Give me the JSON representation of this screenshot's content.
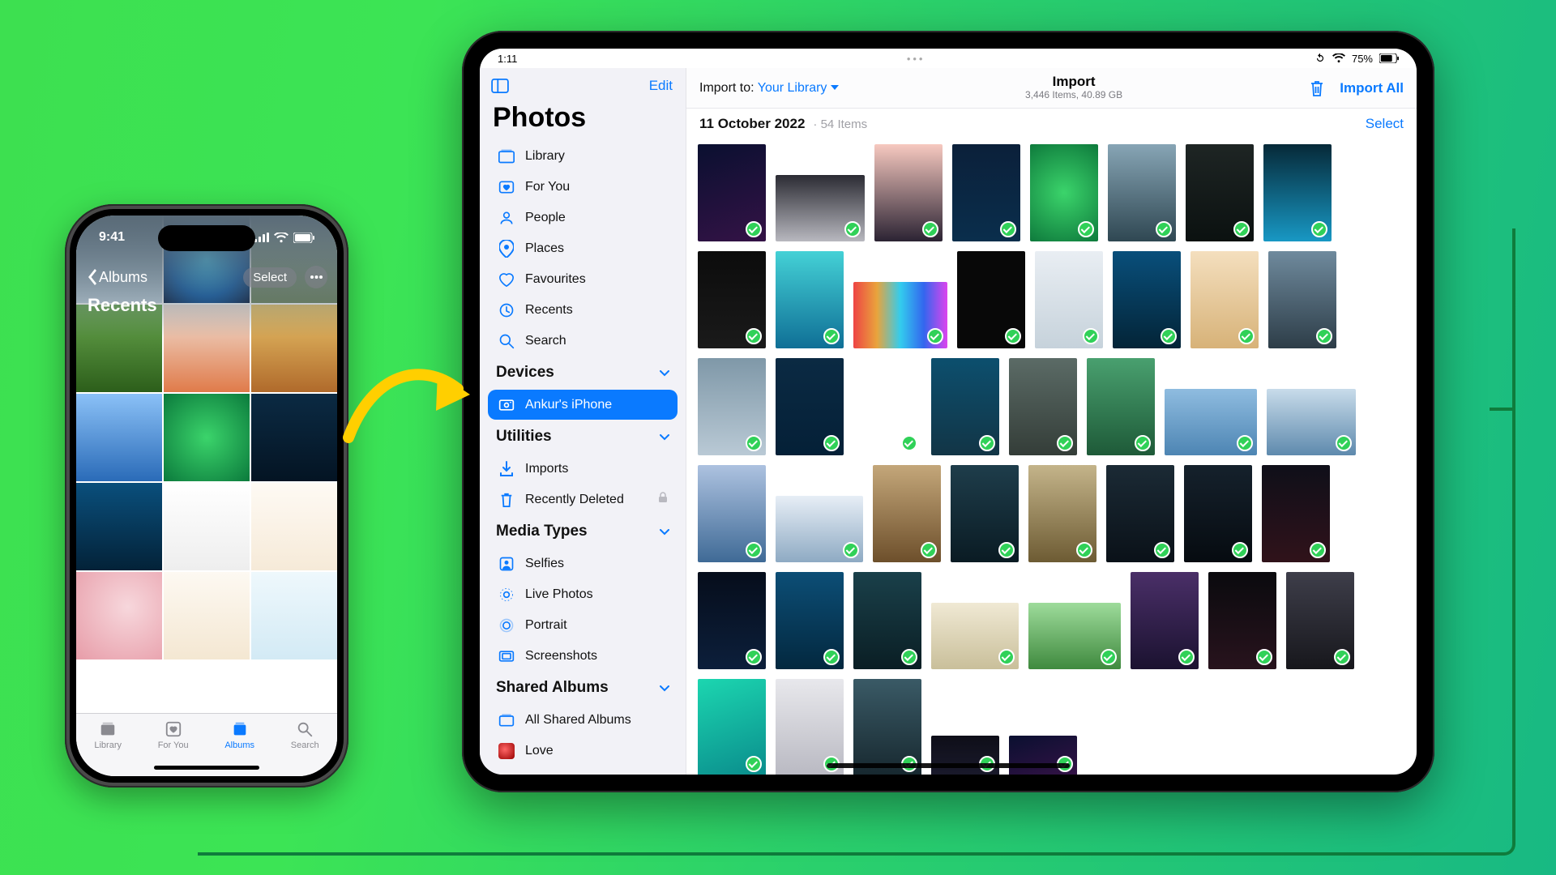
{
  "iphone": {
    "status_time": "9:41",
    "back_label": "Albums",
    "title": "Recents",
    "select_label": "Select",
    "tabs": [
      "Library",
      "For You",
      "Albums",
      "Search"
    ],
    "active_tab": 2
  },
  "ipad": {
    "status_time": "1:11",
    "battery_label": "75%",
    "sidebar": {
      "edit_label": "Edit",
      "title": "Photos",
      "primary": [
        "Library",
        "For You",
        "People",
        "Places",
        "Favourites",
        "Recents",
        "Search"
      ],
      "sections": [
        {
          "header": "Devices",
          "items": [
            "Ankur's iPhone"
          ],
          "selected": 0
        },
        {
          "header": "Utilities",
          "items": [
            "Imports",
            "Recently Deleted"
          ],
          "locked": [
            1
          ]
        },
        {
          "header": "Media Types",
          "items": [
            "Selfies",
            "Live Photos",
            "Portrait",
            "Screenshots"
          ]
        },
        {
          "header": "Shared Albums",
          "items": [
            "All Shared Albums",
            "Love"
          ]
        }
      ]
    },
    "content": {
      "import_to_label": "Import to:",
      "import_to_target": "Your Library",
      "title": "Import",
      "subtitle": "3,446 Items, 40.89 GB",
      "import_all_label": "Import All",
      "date_header": "11 October 2022",
      "count_label": "54 Items",
      "select_label": "Select"
    }
  },
  "thumb_shapes": [
    [
      84,
      120
    ],
    [
      110,
      82
    ],
    [
      84,
      120
    ],
    [
      84,
      120
    ],
    [
      84,
      120
    ],
    [
      84,
      120
    ],
    [
      84,
      120
    ],
    [
      84,
      120
    ],
    [
      84,
      120
    ],
    [
      84,
      120
    ],
    [
      116,
      82
    ],
    [
      84,
      120
    ],
    [
      84,
      120
    ],
    [
      84,
      120
    ],
    [
      84,
      120
    ],
    [
      84,
      120
    ],
    [
      84,
      120
    ],
    [
      84,
      120
    ],
    [
      84,
      120
    ],
    [
      84,
      120
    ],
    [
      84,
      120
    ],
    [
      84,
      120
    ],
    [
      114,
      82
    ],
    [
      110,
      82
    ],
    [
      84,
      120
    ],
    [
      108,
      82
    ],
    [
      84,
      120
    ],
    [
      84,
      120
    ],
    [
      84,
      120
    ],
    [
      84,
      120
    ],
    [
      84,
      120
    ],
    [
      84,
      120
    ],
    [
      84,
      120
    ],
    [
      84,
      120
    ],
    [
      84,
      120
    ],
    [
      108,
      82
    ],
    [
      114,
      82
    ],
    [
      84,
      120
    ],
    [
      84,
      120
    ],
    [
      84,
      120
    ],
    [
      84,
      120
    ],
    [
      84,
      120
    ],
    [
      84,
      120
    ],
    [
      84,
      50
    ],
    [
      84,
      50
    ]
  ]
}
